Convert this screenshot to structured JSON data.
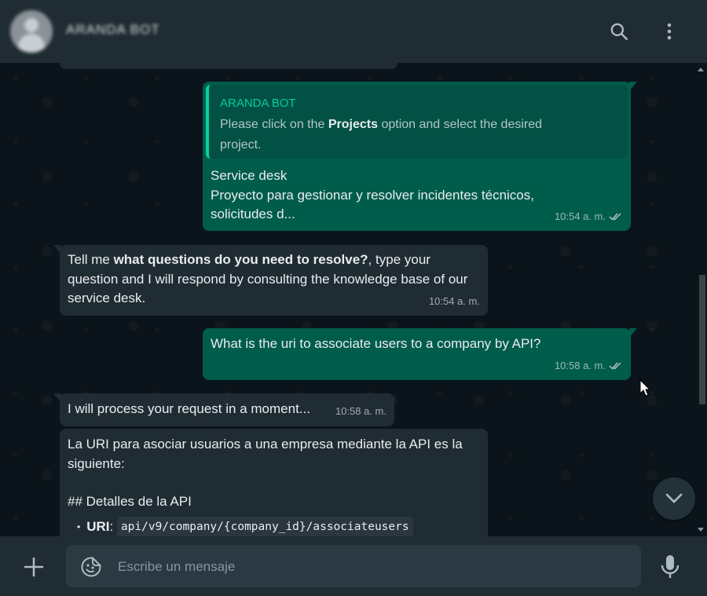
{
  "header": {
    "contact_name": "ARANDA BOT",
    "search_icon": "search-icon",
    "menu_icon": "kebab-menu-icon"
  },
  "messages": [
    {
      "direction": "outgoing",
      "quote_author": "ARANDA BOT",
      "quote_pre": "Please click on the ",
      "quote_bold": "Projects",
      "quote_post": " option and select the desired project.",
      "line1": "Service desk",
      "line2": "Proyecto para gestionar y resolver incidentes técnicos,",
      "line3": "solicitudes d...",
      "time": "10:54 a. m."
    },
    {
      "direction": "incoming",
      "pre": "Tell me ",
      "bold": "what questions do you need to resolve?",
      "post": ", type your question and I will respond by consulting the knowledge base of our service desk.",
      "time": "10:54 a. m."
    },
    {
      "direction": "outgoing",
      "text": "What is the uri to associate users to a company by API?",
      "time": "10:58 a. m."
    },
    {
      "direction": "incoming",
      "text": "I will process your request in a moment...",
      "time": "10:58 a. m."
    },
    {
      "direction": "incoming",
      "line1": "La URI para asociar usuarios a una empresa mediante la API es la siguiente:",
      "heading": "## Detalles de la API",
      "bullet_label": "URI",
      "bullet_sep": ": ",
      "bullet_code": "api/v9/company/{company_id}/associateusers"
    }
  ],
  "footer": {
    "placeholder": "Escribe un mensaje",
    "value": ""
  },
  "colors": {
    "outgoing_bubble": "#005c4b",
    "incoming_bubble": "#202c33",
    "accent": "#06cf9c",
    "background": "#0b141a"
  }
}
